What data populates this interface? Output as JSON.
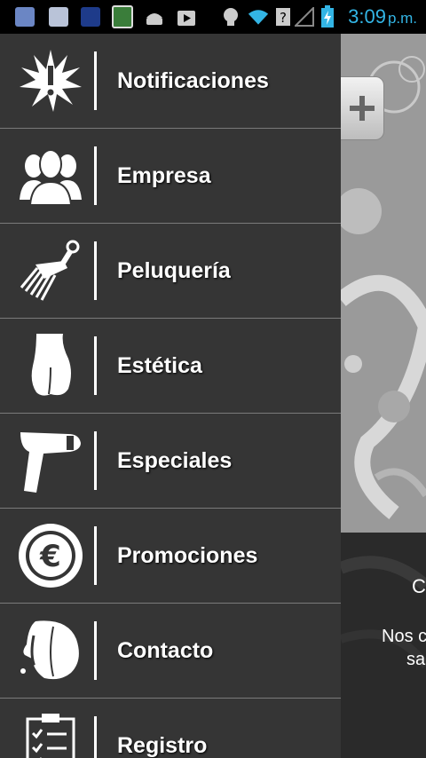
{
  "status_bar": {
    "time": "3:09",
    "ampm": "p.m.",
    "icons": [
      "app-icon-1",
      "app-icon-2",
      "app-icon-3",
      "app-icon-4",
      "android-icon",
      "play-store-icon",
      "bulb-icon",
      "wifi-icon",
      "unknown-signal-icon",
      "signal-icon",
      "battery-charging-icon"
    ],
    "clock_color": "#33b5e5"
  },
  "menu": {
    "items": [
      {
        "label": "Notificaciones",
        "icon": "notification-burst-icon"
      },
      {
        "label": "Empresa",
        "icon": "people-icon"
      },
      {
        "label": "Peluquería",
        "icon": "comb-icon"
      },
      {
        "label": "Estética",
        "icon": "body-icon"
      },
      {
        "label": "Especiales",
        "icon": "laser-device-icon"
      },
      {
        "label": "Promociones",
        "icon": "euro-badge-icon"
      },
      {
        "label": "Contacto",
        "icon": "headset-person-icon"
      },
      {
        "label": "Registro",
        "icon": "checklist-icon"
      }
    ]
  },
  "background": {
    "plus_tab_label": "+",
    "text_line_1": "C",
    "text_line_2": "Nos c",
    "text_line_3": "sa"
  }
}
